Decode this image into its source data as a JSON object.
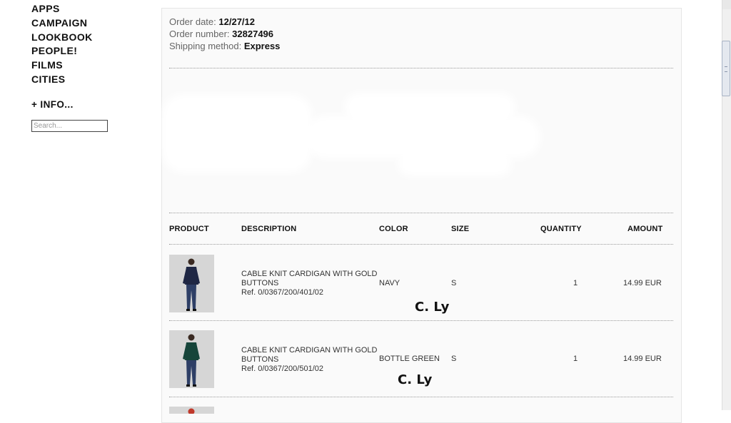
{
  "nav": {
    "items": [
      "APPS",
      "CAMPAIGN",
      "LOOKBOOK",
      "PEOPLE!",
      "FILMS",
      "CITIES"
    ],
    "info": "+ INFO...",
    "search_placeholder": "Search..."
  },
  "order": {
    "date_label": "Order date:",
    "date": "12/27/12",
    "number_label": "Order number:",
    "number": "32827496",
    "shipping_label": "Shipping method:",
    "shipping": "Express"
  },
  "table": {
    "headers": {
      "product": "PRODUCT",
      "description": "DESCRIPTION",
      "color": "COLOR",
      "size": "SIZE",
      "quantity": "QUANTITY",
      "amount": "AMOUNT"
    },
    "rows": [
      {
        "desc_line1": "CABLE KNIT CARDIGAN WITH GOLD",
        "desc_line2": "BUTTONS",
        "ref": "Ref. 0/0367/200/401/02",
        "color": "NAVY",
        "size": "S",
        "quantity": "1",
        "amount": "14.99 EUR",
        "swatch": "#1f2744"
      },
      {
        "desc_line1": "CABLE KNIT CARDIGAN WITH GOLD",
        "desc_line2": "BUTTONS",
        "ref": "Ref. 0/0367/200/501/02",
        "color": "BOTTLE GREEN",
        "size": "S",
        "quantity": "1",
        "amount": "14.99 EUR",
        "swatch": "#16453a"
      }
    ]
  },
  "watermark": "C. Ly"
}
